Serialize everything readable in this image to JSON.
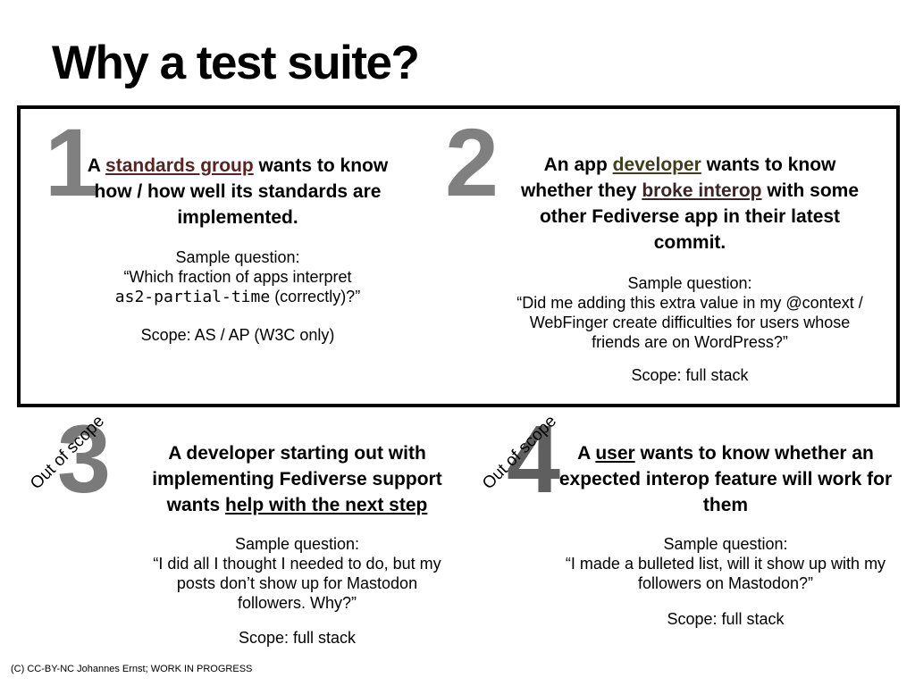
{
  "title": "Why a test suite?",
  "quadrant_1": {
    "number": "1",
    "heading_pre": "A ",
    "heading_link": "standards group",
    "heading_post": " wants to know how / how well its standards are implemented.",
    "sample_label": "Sample question:",
    "sample_q_pre": "“Which fraction of apps interpret",
    "sample_q_code": "as2-partial-time",
    "sample_q_post": " (correctly)?”",
    "scope": "Scope: AS / AP (W3C only)"
  },
  "quadrant_2": {
    "number": "2",
    "heading_pre": "An app ",
    "heading_link_1": "developer",
    "heading_mid": " wants to know whether they ",
    "heading_link_2": "broke interop",
    "heading_post": " with some other Fediverse app in their latest commit.",
    "sample_label": "Sample question:",
    "sample_q": "“Did me adding this extra value in my @context / WebFinger create difficulties for users whose friends are on WordPress?”",
    "scope": "Scope: full stack"
  },
  "quadrant_3": {
    "number": "3",
    "badge": "Out of scope",
    "heading_pre": "A developer starting out with implementing Fediverse support wants ",
    "heading_link": "help with the next step",
    "sample_label": "Sample question:",
    "sample_q": "“I did all I thought I needed to do, but my posts don’t show up for Mastodon followers. Why?”",
    "scope": "Scope: full stack"
  },
  "quadrant_4": {
    "number": "4",
    "badge": "Out of scope",
    "heading_pre": "A ",
    "heading_link": "user",
    "heading_post": " wants to know whether an expected interop feature will work for them",
    "sample_label": "Sample question:",
    "sample_q": "“I made a bulleted list, will it show up with my followers on Mastodon?”",
    "scope": "Scope: full stack"
  },
  "footer": "(C) CC-BY-NC Johannes Ernst; WORK IN PROGRESS"
}
